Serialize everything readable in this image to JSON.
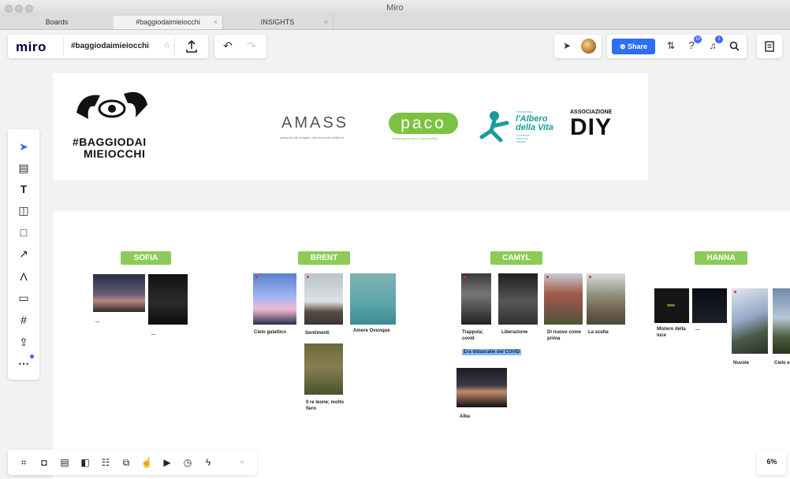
{
  "window": {
    "title": "Miro"
  },
  "tabs": [
    {
      "label": "Boards"
    },
    {
      "label": "#baggiodaimieiocchi"
    },
    {
      "label": "INSIGHTS"
    }
  ],
  "header": {
    "logo": "miro",
    "board_name": "#baggiodaimieiocchi",
    "share_label": "Share",
    "help_badge": "10",
    "notif_badge": "1"
  },
  "banner": {
    "logo_line1": "#BAGGIODAI",
    "logo_line2": "MIEIOCCHI",
    "amass": "AMASS",
    "amass_sub": "acting on the margins: arts as social sculpture",
    "paco": "paco",
    "paco_sub": "designing worlds of opportunities",
    "albero_pre": "FONDAZIONE",
    "albero1": "l'Albero",
    "albero2": "della Vita",
    "albero_sub": "LA NOSTRA ONLUS DI DONNE",
    "diy_top": "ASSOCIAZIONE",
    "diy": "DIY"
  },
  "groups": [
    {
      "name": "SOFIA"
    },
    {
      "name": "BRENT"
    },
    {
      "name": "CAMYL"
    },
    {
      "name": "HANNA"
    }
  ],
  "captions": {
    "sofia1": "...",
    "sofia2": "...",
    "brent1": "Cielo galattico",
    "brent2": "Sentimenti",
    "brent3": "Amore Ovunque",
    "brent4": "Il re leone; molto fiero",
    "camyl1": "Trappola; covid",
    "camyl2": "Liberazione",
    "camyl3": "Di nuovo come prima",
    "camyl4": "La scelta",
    "camyl_note": "Era didascalie del COVID",
    "camyl5": "Alba",
    "hanna1": "Mistero della luce",
    "hanna2": "...",
    "hanna3": "Nuvole",
    "hanna4": "Cielo e alberi"
  },
  "zoom": "6%",
  "colors": {
    "accent": "#2d6ef2",
    "label_green": "#8dcb59",
    "badge_blue": "#4262ff"
  }
}
